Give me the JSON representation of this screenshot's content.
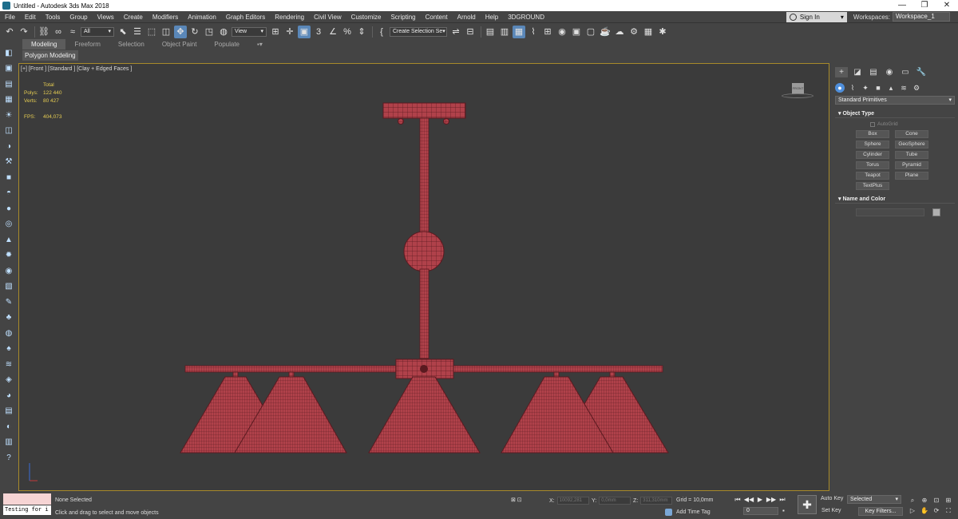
{
  "window": {
    "title": "Untitled - Autodesk 3ds Max 2018",
    "controls": [
      "—",
      "❐",
      "✕"
    ]
  },
  "menu": {
    "items": [
      "File",
      "Edit",
      "Tools",
      "Group",
      "Views",
      "Create",
      "Modifiers",
      "Animation",
      "Graph Editors",
      "Rendering",
      "Civil View",
      "Customize",
      "Scripting",
      "Content",
      "Arnold",
      "Help",
      "3DGROUND"
    ],
    "sign_in": "Sign In",
    "workspaces_label": "Workspaces:",
    "workspace_value": "Workspace_1"
  },
  "toolbar": {
    "selection_filter": "All",
    "ref_coord": "View",
    "named_selection_set": "Create Selection Se"
  },
  "ribbon": {
    "tabs": [
      "Modeling",
      "Freeform",
      "Selection",
      "Object Paint",
      "Populate"
    ],
    "active_panel": "Polygon Modeling"
  },
  "viewport": {
    "label": "[+] [Front ] [Standard ] [Clay + Edged Faces ]",
    "stats_total": "Total",
    "polys_label": "Polys:",
    "polys_value": "122 440",
    "verts_label": "Verts:",
    "verts_value": "80 427",
    "fps_label": "FPS:",
    "fps_value": "404,073",
    "viewcube_face": "FRONT",
    "model_color": "#b0414a",
    "wire_color": "#5a1a20"
  },
  "command_panel": {
    "category_dropdown": "Standard Primitives",
    "object_type_title": "Object Type",
    "autogrid_label": "AutoGrid",
    "primitives": [
      "Box",
      "Cone",
      "Sphere",
      "GeoSphere",
      "Cylinder",
      "Tube",
      "Torus",
      "Pyramid",
      "Teapot",
      "Plane",
      "TextPlus"
    ],
    "name_color_title": "Name and Color"
  },
  "status": {
    "script_input": "Testing for i",
    "selection": "None Selected",
    "prompt": "Click and drag to select and move objects",
    "x_label": "X:",
    "x_value": "10092,281",
    "y_label": "Y:",
    "y_value": "0,0mm",
    "z_label": "Z:",
    "z_value": "311,310mm",
    "grid": "Grid = 10,0mm",
    "add_time_tag": "Add Time Tag",
    "frame_value": "0",
    "auto_key": "Auto Key",
    "set_key": "Set Key",
    "selected_dropdown": "Selected",
    "key_filters": "Key Filters..."
  }
}
